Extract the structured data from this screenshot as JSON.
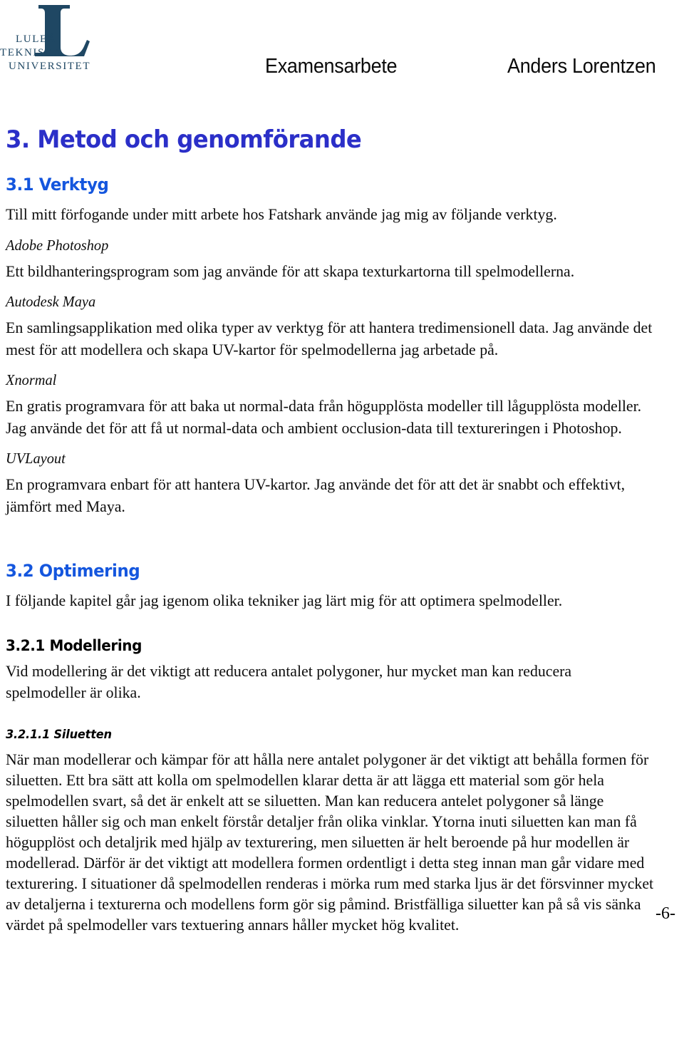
{
  "header": {
    "logo": {
      "name": "lulea-tekniska-universitet-logo",
      "line1": "LULEÅ",
      "line2": "TEKNISKA",
      "line3": "UNIVERSITET",
      "monogram": "L",
      "color": "#1f4763"
    },
    "title": "Examensarbete",
    "author": "Anders Lorentzen"
  },
  "colors": {
    "chapter_heading": "#2b2fc8",
    "section_heading": "#1456de",
    "body_text": "#0d0d0d",
    "logo_navy": "#1f4763",
    "page_background": "#ffffff"
  },
  "document": {
    "chapter_title": "3. Metod och genomförande",
    "section_3_1": {
      "title": "3.1 Verktyg",
      "intro": "Till mitt förfogande under mitt arbete hos Fatshark använde jag mig av följande verktyg.",
      "tools": [
        {
          "name": "Adobe Photoshop",
          "description": "Ett bildhanteringsprogram som jag använde för att skapa texturkartorna till spelmodellerna."
        },
        {
          "name": "Autodesk Maya",
          "description": "En samlingsapplikation med olika typer av verktyg för att hantera tredimensionell data. Jag använde det mest för att modellera och skapa UV-kartor för spelmodellerna jag arbetade på."
        },
        {
          "name": "Xnormal",
          "description": "En gratis programvara för att baka ut normal-data från högupplösta modeller till lågupplösta modeller. Jag använde det för att få ut normal-data och ambient occlusion-data till textureringen i Photoshop."
        },
        {
          "name": "UVLayout",
          "description": "En programvara enbart för att hantera UV-kartor. Jag använde det för att det är snabbt och effektivt, jämfört med Maya."
        }
      ]
    },
    "section_3_2": {
      "title": "3.2 Optimering",
      "intro": "I följande kapitel går jag igenom olika tekniker jag lärt mig för att optimera spelmodeller.",
      "subsection_3_2_1": {
        "title": "3.2.1 Modellering",
        "body": "Vid modellering är det viktigt att reducera antalet polygoner, hur mycket man kan reducera spelmodeller är olika.",
        "subsubsection_3_2_1_1": {
          "title": "3.2.1.1 Siluetten",
          "body": "När man modellerar och kämpar för att hålla nere antalet polygoner är det viktigt att behålla formen för siluetten. Ett bra sätt att kolla om spelmodellen klarar detta är att lägga ett material som gör hela spelmodellen svart, så det är enkelt att se siluetten. Man kan reducera antelet polygoner så länge siluetten håller sig och man enkelt förstår detaljer från olika vinklar. Ytorna inuti siluetten kan man få högupplöst och detaljrik med hjälp av texturering, men siluetten är helt beroende på hur modellen är modellerad. Därför är det viktigt att modellera formen ordentligt i detta steg innan man går vidare med texturering. I situationer då spelmodellen renderas i mörka rum med starka ljus är det försvinner mycket av detaljerna i texturerna och modellens form gör sig påmind. Bristfälliga siluetter kan på så vis sänka värdet på spelmodeller vars textuering annars håller mycket hög kvalitet."
        }
      }
    }
  },
  "footer": {
    "page_number": "-6-"
  }
}
